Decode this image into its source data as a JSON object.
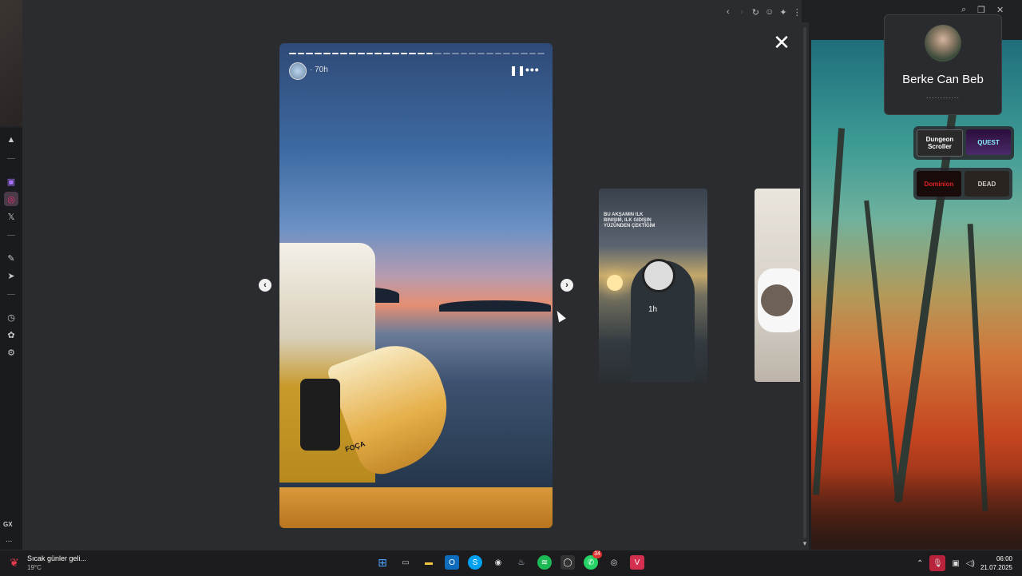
{
  "story": {
    "time": "70h",
    "progress_total": 30,
    "progress_done": 17,
    "boat_label": "FOÇA"
  },
  "thumbs": {
    "first_caption": "BU AKŞAMIN ILK BINIŞIM, ILK GIDIŞIN YÜZÜNDEN ÇEKTİĞİM",
    "first_age": "1h"
  },
  "call": {
    "name": "Berke Can Beb",
    "status": "............"
  },
  "games": {
    "row1": [
      "Dungeon Scroller",
      "QUEST"
    ],
    "row2": [
      "Dominion",
      "DEAD"
    ]
  },
  "sidebar": {
    "gx_label": "GX",
    "more": "..."
  },
  "taskbar": {
    "weather_text": "Sıcak günler geli...",
    "weather_temp": "19°C",
    "whatsapp_badge": "34",
    "time": "06:00",
    "date": "21.07.2025"
  },
  "icons": {
    "close": "close-icon",
    "prev": "chevron-left-icon",
    "next": "chevron-right-icon",
    "pause": "pause-icon",
    "more": "more-icon"
  }
}
